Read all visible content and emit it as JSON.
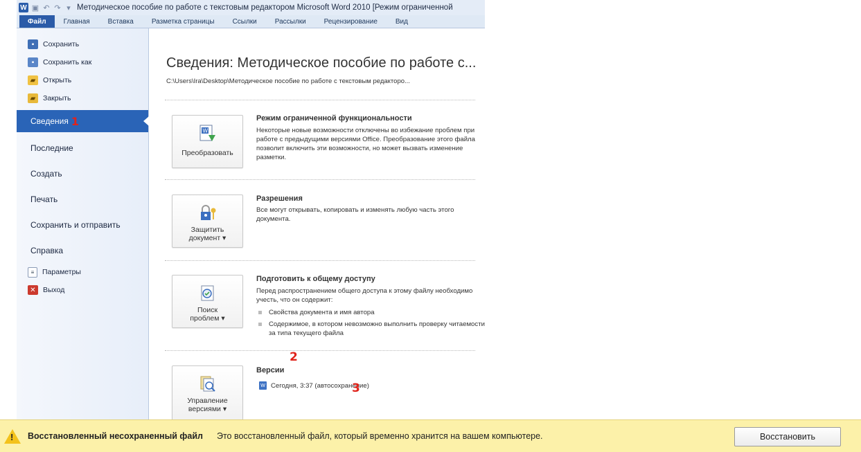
{
  "window": {
    "title": "Методическое пособие по работе с  текстовым  редактором Microsoft Word 2010 [Режим ограниченной"
  },
  "ribbon": {
    "tabs": [
      {
        "label": "Файл"
      },
      {
        "label": "Главная"
      },
      {
        "label": "Вставка"
      },
      {
        "label": "Разметка страницы"
      },
      {
        "label": "Ссылки"
      },
      {
        "label": "Рассылки"
      },
      {
        "label": "Рецензирование"
      },
      {
        "label": "Вид"
      }
    ]
  },
  "nav": {
    "save": "Сохранить",
    "save_as": "Сохранить как",
    "open": "Открыть",
    "close": "Закрыть",
    "active": "Сведения",
    "active_marker": "1",
    "recent": "Последние",
    "create": "Создать",
    "print": "Печать",
    "save_send": "Сохранить и отправить",
    "help": "Справка",
    "params": "Параметры",
    "exit": "Выход"
  },
  "info": {
    "title": "Сведения: Методическое пособие по работе с...",
    "path": "C:\\Users\\Ira\\Desktop\\Методическое пособие по работе с  текстовым  редакторо..."
  },
  "sections": {
    "compat": {
      "button": "Преобразовать",
      "title": "Режим ограниченной функциональности",
      "text": "Некоторые новые возможности отключены во избежание проблем при работе с предыдущими версиями Office. Преобразование этого файла позволит включить эти возможности, но может вызвать изменение разметки."
    },
    "permissions": {
      "button_line1": "Защитить",
      "button_line2": "документ ▾",
      "title": "Разрешения",
      "text": "Все могут открывать, копировать и изменять любую часть этого документа."
    },
    "prepare": {
      "button_line1": "Поиск",
      "button_line2": "проблем ▾",
      "title": "Подготовить к общему доступу",
      "text": "Перед распространением общего доступа к этому файлу необходимо учесть, что он содержит:",
      "bullet1": "Свойства документа и имя автора",
      "bullet2": "Содержимое, в котором невозможно выполнить проверку читаемости из-за типа текущего файла"
    },
    "versions": {
      "button_line1": "Управление",
      "button_line2": "версиями ▾",
      "title": "Версии",
      "entry": "Сегодня, 3:37 (автосохранение)",
      "marker2": "2",
      "marker3": "3"
    }
  },
  "infobar": {
    "title": "Восстановленный несохраненный файл",
    "text": "Это восстановленный файл, который временно хранится на вашем компьютере.",
    "button": "Восстановить"
  },
  "colors": {
    "file_tab": "#2b5ba8",
    "nav_active": "#2a64b7",
    "infobar": "#fcf1a9",
    "marker": "#e0231b"
  }
}
